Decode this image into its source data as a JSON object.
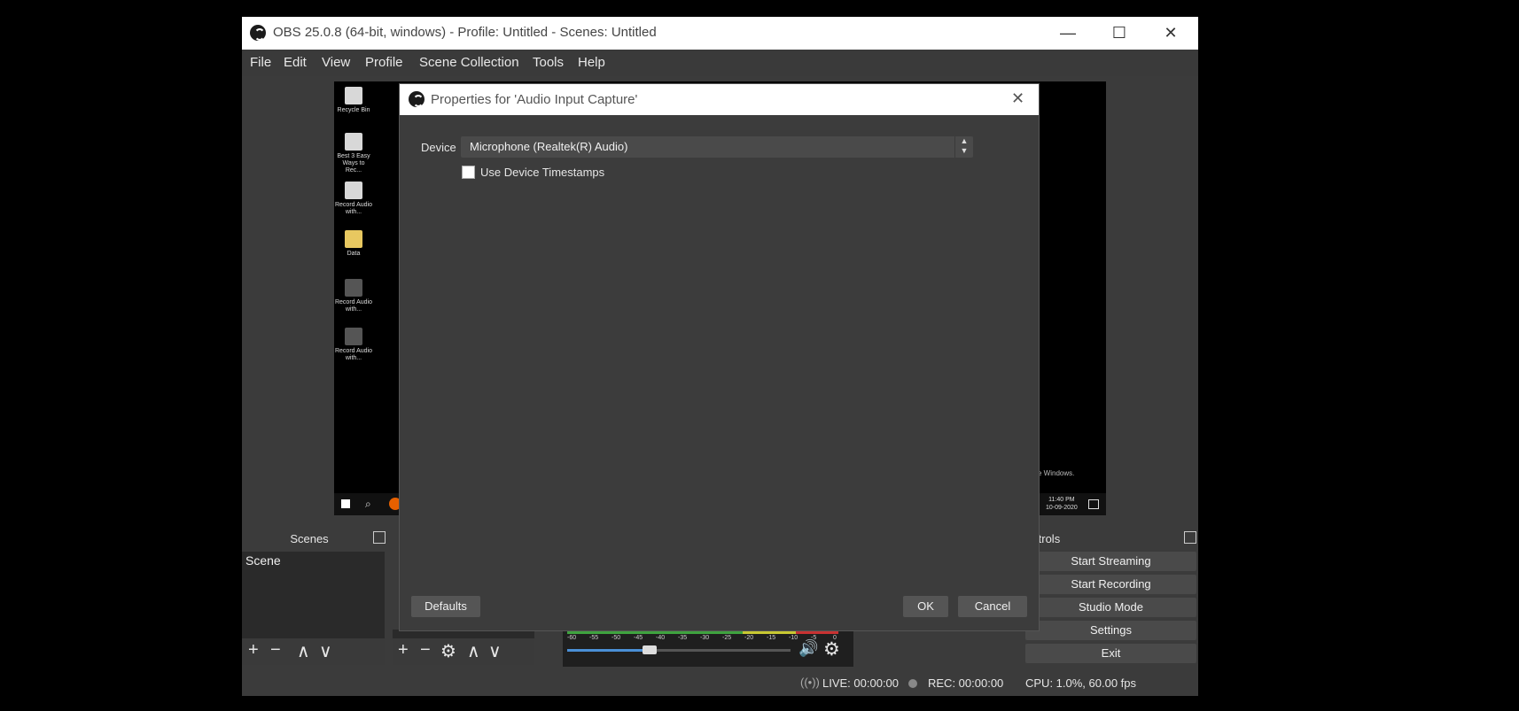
{
  "window": {
    "title": "OBS 25.0.8 (64-bit, windows) - Profile: Untitled - Scenes: Untitled",
    "minimize_glyph": "—",
    "maximize_glyph": "☐",
    "close_glyph": "✕"
  },
  "menu": {
    "items": [
      "File",
      "Edit",
      "View",
      "Profile",
      "Scene Collection",
      "Tools",
      "Help"
    ]
  },
  "preview": {
    "desktop_icons": [
      "Recycle Bin",
      "Best 3 Easy Ways to Rec...",
      "Record Audio with...",
      "Data",
      "Record Audio with...",
      "Record Audio with..."
    ],
    "watermark": "e Windows.",
    "clock_time": "11:40 PM",
    "clock_date": "10-09-2020"
  },
  "scenes": {
    "title": "Scenes",
    "items": [
      "Scene"
    ]
  },
  "mixer": {
    "ticks": [
      "-60",
      "-55",
      "-50",
      "-45",
      "-40",
      "-35",
      "-30",
      "-25",
      "-20",
      "-15",
      "-10",
      "-5",
      "0"
    ],
    "volume": 0.37
  },
  "controls": {
    "title": "Controls",
    "buttons": [
      "Start Streaming",
      "Start Recording",
      "Studio Mode",
      "Settings",
      "Exit"
    ]
  },
  "status": {
    "live": "LIVE: 00:00:00",
    "rec": "REC: 00:00:00",
    "cpu": "CPU: 1.0%, 60.00 fps"
  },
  "dialog": {
    "title": "Properties for 'Audio Input Capture'",
    "device_label": "Device",
    "device_value": "Microphone (Realtek(R) Audio)",
    "timestamps_label": "Use Device Timestamps",
    "defaults_label": "Defaults",
    "ok_label": "OK",
    "cancel_label": "Cancel"
  },
  "icons": {
    "add": "+",
    "remove": "−",
    "up": "∧",
    "down": "∨",
    "gear": "⚙",
    "speaker": "🔊"
  },
  "colors": {
    "meter_green": "#3fa33f",
    "meter_yellow": "#c8c832",
    "meter_red": "#c83232",
    "slider_blue": "#4a8fd6"
  }
}
